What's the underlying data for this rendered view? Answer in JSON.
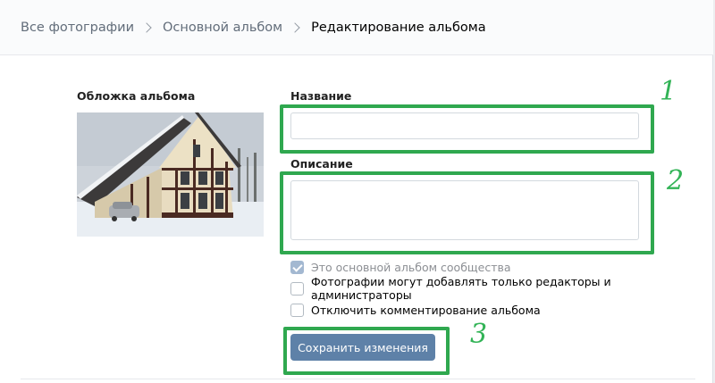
{
  "breadcrumbs": {
    "all_photos": "Все фотографии",
    "main_album": "Основной альбом",
    "current": "Редактирование альбома"
  },
  "cover": {
    "label": "Обложка альбома"
  },
  "form": {
    "name_label": "Название",
    "name_value": "",
    "description_label": "Описание",
    "description_value": "",
    "options": [
      {
        "label": "Это основной альбом сообщества",
        "checked": true,
        "disabled": true
      },
      {
        "label": "Фотографии могут добавлять только редакторы и администраторы",
        "checked": false,
        "disabled": false
      },
      {
        "label": "Отключить комментирование альбома",
        "checked": false,
        "disabled": false
      }
    ],
    "save_label": "Сохранить изменения"
  },
  "annotations": {
    "one": "1",
    "two": "2",
    "three": "3"
  },
  "colors": {
    "highlight": "#2fa84f",
    "button": "#5e81a8"
  }
}
